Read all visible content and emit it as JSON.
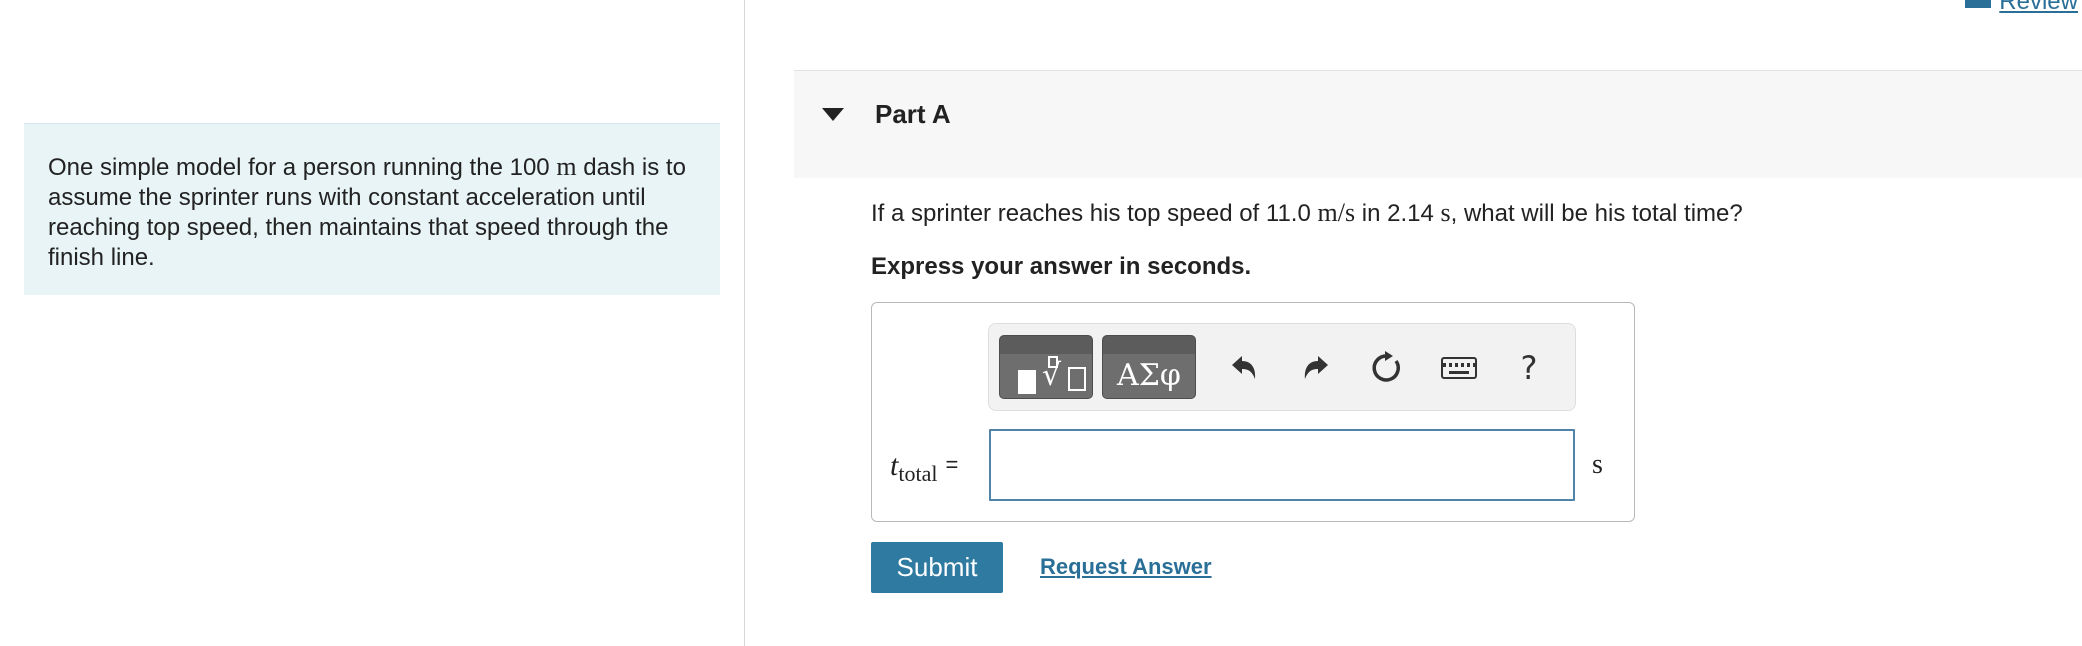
{
  "intro": {
    "text_before": "One simple model for a person running the 100",
    "unit_m": "m",
    "text_after": "dash is to assume the sprinter runs with constant acceleration until reaching top speed, then maintains that speed through the finish line."
  },
  "header": {
    "review_label": "Review"
  },
  "part": {
    "title": "Part A"
  },
  "question": {
    "text_1": "If a sprinter reaches his top speed of 11.0",
    "unit_speed": "m/s",
    "text_2": "in 2.14",
    "unit_time": "s",
    "text_3": ", what will be his total time?"
  },
  "instruction": "Express your answer in seconds.",
  "toolbar": {
    "greek_label": "ΑΣφ",
    "help_label": "?"
  },
  "answer": {
    "variable": "t",
    "subscript": "total",
    "equals": "=",
    "value": "",
    "unit": "s"
  },
  "actions": {
    "submit_label": "Submit",
    "request_answer_label": "Request Answer"
  },
  "colors": {
    "accent": "#2f7aa1",
    "link": "#2a6f97",
    "intro_bg": "#e8f4f6"
  }
}
